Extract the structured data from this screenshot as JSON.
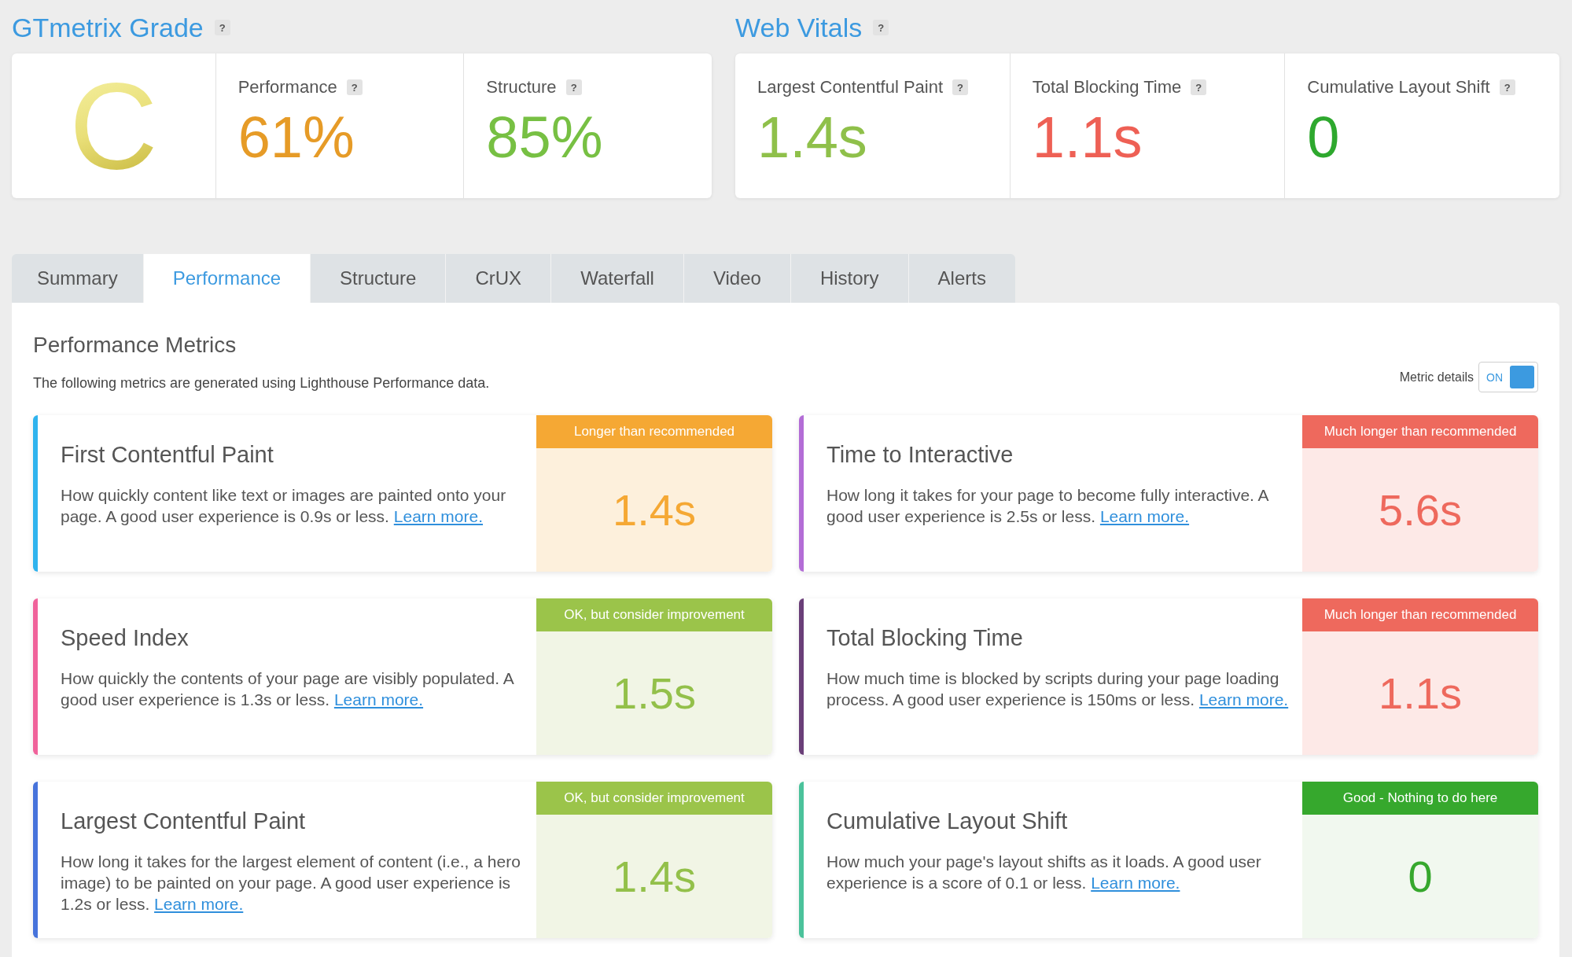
{
  "grade": {
    "title": "GTmetrix Grade",
    "help": "?",
    "letter": "C",
    "scores": [
      {
        "label": "Performance",
        "help": "?",
        "value": "61%",
        "color": "#e69b27"
      },
      {
        "label": "Structure",
        "help": "?",
        "value": "85%",
        "color": "#77c043"
      }
    ]
  },
  "web_vitals": {
    "title": "Web Vitals",
    "help": "?",
    "items": [
      {
        "label": "Largest Contentful Paint",
        "help": "?",
        "value": "1.4s",
        "color": "#8fc04a"
      },
      {
        "label": "Total Blocking Time",
        "help": "?",
        "value": "1.1s",
        "color": "#ee6055"
      },
      {
        "label": "Cumulative Layout Shift",
        "help": "?",
        "value": "0",
        "color": "#2ea82e"
      }
    ]
  },
  "tabs": [
    {
      "label": "Summary",
      "selected": false
    },
    {
      "label": "Performance",
      "selected": true
    },
    {
      "label": "Structure",
      "selected": false
    },
    {
      "label": "CrUX",
      "selected": false
    },
    {
      "label": "Waterfall",
      "selected": false
    },
    {
      "label": "Video",
      "selected": false
    },
    {
      "label": "History",
      "selected": false
    },
    {
      "label": "Alerts",
      "selected": false
    }
  ],
  "panel": {
    "title": "Performance Metrics",
    "description": "The following metrics are generated using Lighthouse Performance data.",
    "metric_details": {
      "label": "Metric details",
      "toggle": {
        "text": "ON",
        "on": true
      }
    }
  },
  "metrics": [
    {
      "title": "First Contentful Paint",
      "description": "How quickly content like text or images are painted onto your page. A good user experience is 0.9s or less.",
      "link": "Learn more.",
      "color": "#2fb3ee",
      "status": "Longer than recommended",
      "kind": "warning",
      "value": "1.4s"
    },
    {
      "title": "Time to Interactive",
      "description": "How long it takes for your page to become fully interactive. A good user experience is 2.5s or less.",
      "link": "Learn more.",
      "color": "#b36dd6",
      "status": "Much longer than recommended",
      "kind": "poor",
      "value": "5.6s"
    },
    {
      "title": "Speed Index",
      "description": "How quickly the contents of your page are visibly populated. A good user experience is 1.3s or less.",
      "link": "Learn more.",
      "color": "#f0639b",
      "status": "OK, but consider improvement",
      "kind": "fair",
      "value": "1.5s"
    },
    {
      "title": "Total Blocking Time",
      "description": "How much time is blocked by scripts during your page loading process. A good user experience is 150ms or less.",
      "link": "Learn more.",
      "color": "#6a3f78",
      "status": "Much longer than recommended",
      "kind": "poor",
      "value": "1.1s"
    },
    {
      "title": "Largest Contentful Paint",
      "description": "How long it takes for the largest element of content (i.e., a hero image) to be painted on your page. A good user experience is 1.2s or less.",
      "link": "Learn more.",
      "color": "#4673db",
      "status": "OK, but consider improvement",
      "kind": "fair",
      "value": "1.4s"
    },
    {
      "title": "Cumulative Layout Shift",
      "description": "How much your page's layout shifts as it loads. A good user experience is a score of 0.1 or less.",
      "link": "Learn more.",
      "color": "#4bc29b",
      "status": "Good - Nothing to do here",
      "kind": "good",
      "value": "0"
    }
  ]
}
